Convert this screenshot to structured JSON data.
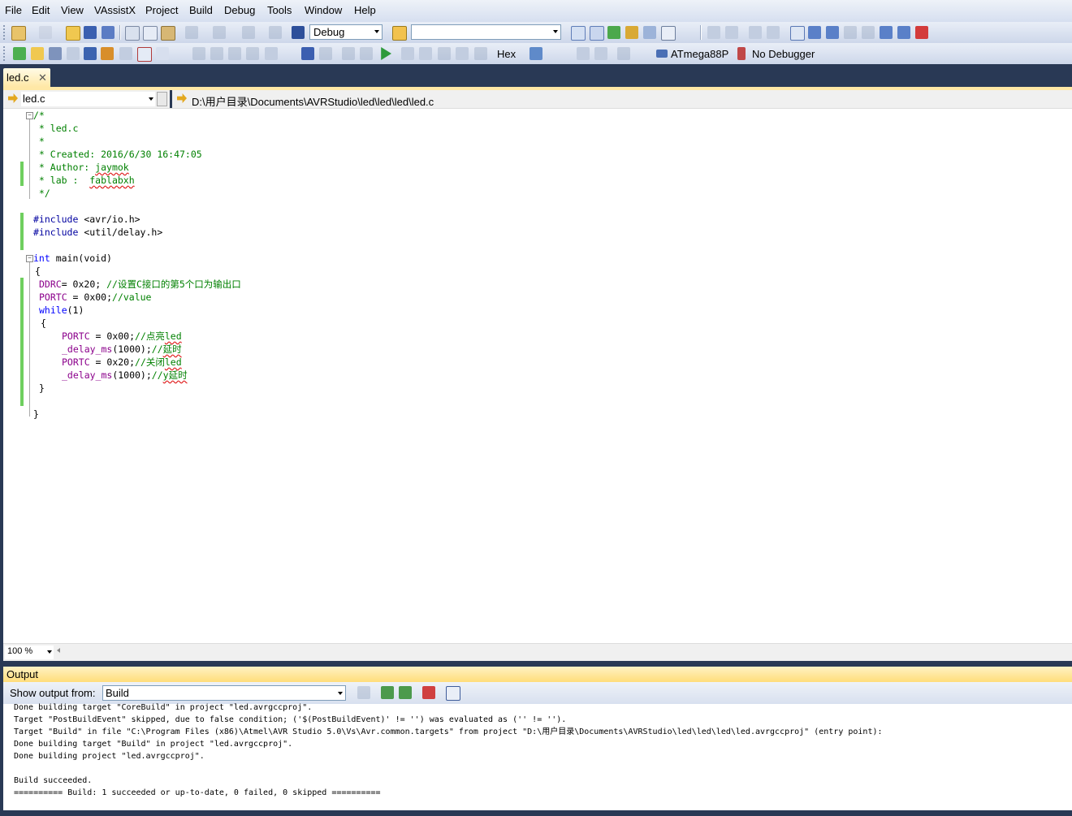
{
  "menu": [
    "File",
    "Edit",
    "View",
    "VAssistX",
    "Project",
    "Build",
    "Debug",
    "Tools",
    "Window",
    "Help"
  ],
  "toolbar": {
    "config": "Debug",
    "search_value": "",
    "hex_label": "Hex",
    "device": "ATmega88P",
    "debugger": "No Debugger"
  },
  "tab": {
    "label": "led.c",
    "close": "✕"
  },
  "navbar": {
    "file_combo": "led.c",
    "path": "D:\\用户目录\\Documents\\AVRStudio\\led\\led\\led\\led.c"
  },
  "code": {
    "l1": "/*",
    "l2": " * led.c",
    "l3": " *",
    "l4": " * Created: 2016/6/30 16:47:05",
    "l5a": " * Author: ",
    "l5b": "jaymok",
    "l6a": " * lab :  ",
    "l6b": "fablabxh",
    "l7": " */",
    "inc1a": "#include",
    "inc1b": " <avr/io.h>",
    "inc2a": "#include",
    "inc2b": " <util/delay.h>",
    "main_kw": "int",
    "main_rest": " main(void)",
    "brace_open": "{",
    "ddrc": "DDRC",
    "ddrc_rest": "= 0x20; ",
    "ddrc_cm": "//设置C接口的第5个口为输出口",
    "portc": "PORTC",
    "portc_rest": " = 0x00;",
    "portc_cm": "//value",
    "while_kw": "while",
    "while_rest": "(1)",
    "inner_open": "{",
    "p1": "PORTC",
    "p1_rest": " = 0x00;",
    "p1_cm": "//点亮",
    "p1_sq": "led",
    "d1": "_delay_ms",
    "d1_rest": "(1000);",
    "d1_cm": "//",
    "d1_sq": "延时",
    "p2": "PORTC",
    "p2_rest": " = 0x20;",
    "p2_cm": "//关闭",
    "p2_sq": "led",
    "d2": "_delay_ms",
    "d2_rest": "(1000);",
    "d2_cm": "//",
    "d2_sq": "y延时",
    "inner_close": "}",
    "brace_close": "}"
  },
  "zoom": "100 %",
  "output": {
    "title": "Output",
    "show_from_label": "Show output from:",
    "source": "Build",
    "lines": [
      "Done building target \"CoreBuild\" in project \"led.avrgccproj\".",
      "Target \"PostBuildEvent\" skipped, due to false condition; ('$(PostBuildEvent)' != '') was evaluated as ('' != '').",
      "Target \"Build\" in file \"C:\\Program Files (x86)\\Atmel\\AVR Studio 5.0\\Vs\\Avr.common.targets\" from project \"D:\\用户目录\\Documents\\AVRStudio\\led\\led\\led\\led.avrgccproj\" (entry point):",
      "Done building target \"Build\" in project \"led.avrgccproj\".",
      "Done building project \"led.avrgccproj\".",
      "",
      "Build succeeded.",
      "========== Build: 1 succeeded or up-to-date, 0 failed, 0 skipped =========="
    ]
  },
  "colors": {
    "chrome_dark": "#293955",
    "tab_active": "#ffe8a6",
    "comment": "#008000",
    "keyword": "#0000ff",
    "variable": "#8b008b",
    "changed_bar": "#6fcf5f"
  }
}
